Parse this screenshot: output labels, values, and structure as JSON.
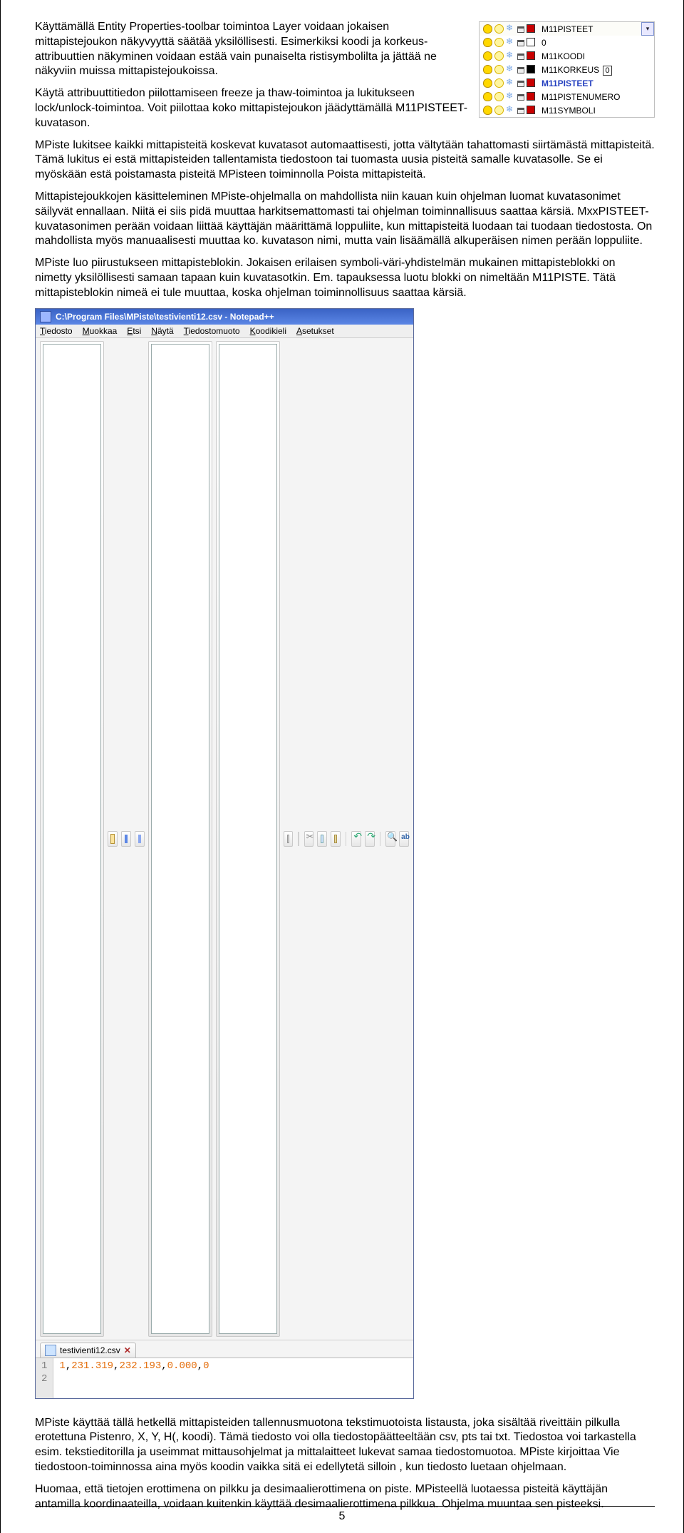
{
  "paragraphs": {
    "p1": "Käyttämällä Entity Properties-toolbar toimintoa Layer voidaan jokaisen mittapistejoukon näkyvyyttä säätää yksilöllisesti. Esimerkiksi koodi ja korkeus-attribuuttien näkyminen voidaan estää vain punaiselta ristisymbolilta ja jättää ne näkyviin muissa mittapistejoukoissa.",
    "p2": "Käytä attribuuttitiedon piilottamiseen freeze ja thaw-toimintoa ja lukitukseen lock/unlock-toimintoa. Voit piilottaa koko mittapistejoukon jäädyttämällä M11PISTEET-kuvatason.",
    "p3a": "MPiste lukitsee kaikki mittapisteitä koskevat kuvatasot automaattisesti, jotta vältytään tahattomasti siirtämästä mittapisteitä. Tämä lukitus ei estä mittapisteiden tallentamista tiedostoon tai tuomasta uusia pisteitä samalle kuvatasolle. Se ei myöskään estä poistamasta pisteitä MPisteen toiminnolla Poista mittapisteitä.",
    "p4": "Mittapistejoukkojen käsitteleminen MPiste-ohjelmalla on mahdollista niin kauan kuin ohjelman luomat kuvatasonimet säilyvät ennallaan. Niitä ei siis pidä muuttaa harkitsemattomasti tai ohjelman toiminnallisuus saattaa kärsiä. MxxPISTEET- kuvatasonimen perään voidaan liittää käyttäjän määrittämä loppuliite, kun mittapisteitä luodaan tai tuodaan tiedostosta. On mahdollista myös manuaalisesti muuttaa ko. kuvatason nimi, mutta vain lisäämällä alkuperäisen nimen perään loppuliite.",
    "p5": "MPiste luo piirustukseen mittapisteblokin. Jokaisen erilaisen symboli-väri-yhdistelmän mukainen mittapisteblokki on nimetty yksilöllisesti samaan tapaan kuin kuvatasotkin. Em. tapauksessa luotu blokki on nimeltään M11PISTE. Tätä mittapisteblokin nimeä ei tule muuttaa, koska ohjelman toiminnollisuus saattaa  kärsiä.",
    "p6": "MPiste käyttää tällä hetkellä mittapisteiden tallennusmuotona tekstimuotoista listausta, joka sisältää riveittäin pilkulla erotettuna Pistenro, X, Y, H(, koodi). Tämä tiedosto voi olla tiedostopäätteeltään csv, pts tai txt. Tiedostoa voi tarkastella esim. tekstieditorilla ja useimmat mittausohjelmat ja mittalaitteet lukevat samaa tiedostomuotoa. MPiste kirjoittaa Vie tiedostoon-toiminnossa aina myös koodin vaikka sitä ei edellytetä silloin , kun tiedosto luetaan ohjelmaan.",
    "p7": "Huomaa, että tietojen erottimena on pilkku ja desimaalierottimena on piste. MPisteellä luotaessa pisteitä käyttäjän antamilla koordinaateilla, voidaan kuitenkin käyttää desimaalierottimena pilkkua. Ohjelma muuntaa sen pisteeksi."
  },
  "layers": {
    "header_name": "M11PISTEET",
    "rows": [
      {
        "name": "0",
        "swatch": "white"
      },
      {
        "name": "M11KOODI",
        "swatch": "red"
      },
      {
        "name": "M11KORKEUS",
        "swatch": "black",
        "boxed": "0"
      },
      {
        "name": "M11PISTEET",
        "swatch": "red",
        "bold": true
      },
      {
        "name": "M11PISTENUMERO",
        "swatch": "red"
      },
      {
        "name": "M11SYMBOLI",
        "swatch": "red"
      }
    ]
  },
  "npp": {
    "title": "C:\\Program Files\\MPiste\\testivienti12.csv - Notepad++",
    "menus": [
      "Tiedosto",
      "Muokkaa",
      "Etsi",
      "Näytä",
      "Tiedostomuoto",
      "Koodikieli",
      "Asetukset"
    ],
    "tab_name": "testivienti12.csv",
    "line_numbers": [
      "1",
      "2"
    ],
    "code_line": "1,231.319,232.193,0.000,0"
  },
  "page_number": "5"
}
